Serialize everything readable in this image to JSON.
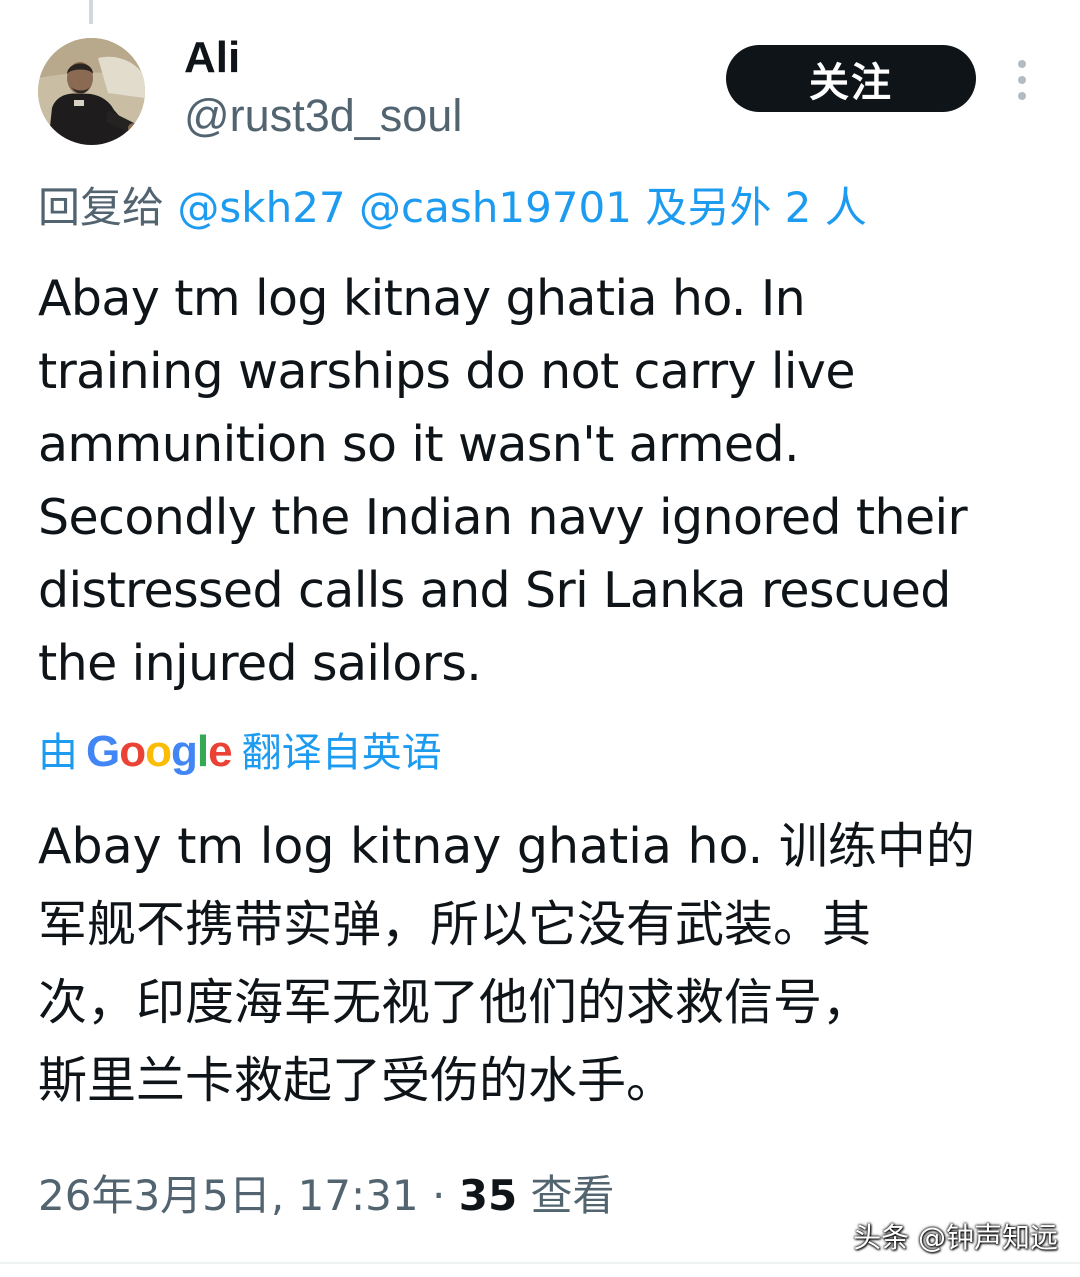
{
  "author": {
    "display_name": "Ali",
    "handle": "@rust3d_soul"
  },
  "follow_button": {
    "label": "关注"
  },
  "reply": {
    "prefix": "回复给",
    "mentions": [
      "@skh27",
      "@cash19701"
    ],
    "suffix": "及另外 2 人"
  },
  "tweet": {
    "text": "Abay tm log kitnay ghatia ho. In\ntraining warships do not carry live\nammunition so it wasn't armed.\nSecondly the Indian navy ignored their\ndistressed calls and Sri Lanka rescued\nthe injured sailors."
  },
  "translation": {
    "by_label": "由",
    "provider": "Google",
    "source_label": "翻译自英语",
    "text": "Abay tm log kitnay ghatia ho. 训练中的\n军舰不携带实弹，所以它没有武装。其\n次，印度海军无视了他们的求救信号，\n斯里兰卡救起了受伤的水手。"
  },
  "meta": {
    "timestamp": "26年3月5日, 17:31",
    "separator": "·",
    "view_count": "35",
    "view_label": "查看"
  },
  "watermark": {
    "text": "头条 @钟声知远"
  },
  "colors": {
    "accent": "#1d9bf0",
    "text_primary": "#0f1419",
    "text_secondary": "#536471",
    "button_bg": "#0f1419"
  },
  "icons": {
    "more": "more-vertical-icon"
  }
}
